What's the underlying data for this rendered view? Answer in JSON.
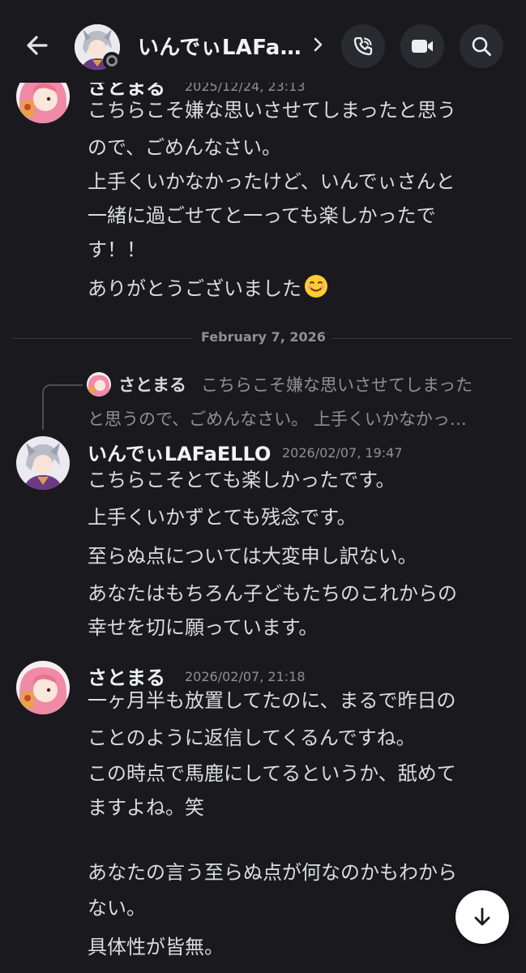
{
  "header": {
    "title": "いんでぃLAFa…",
    "icons": [
      "back-arrow-icon",
      "chevron-right-icon",
      "voice-call-icon",
      "video-call-icon",
      "search-icon"
    ]
  },
  "messages": [
    {
      "author": "さとまる",
      "timestamp": "2025/12/24, 23:13",
      "lines": [
        "こちらこそ嫌な思いさせてしまったと思う",
        "ので、ごめんなさい。",
        "上手くいかなかったけど、いんでぃさんと",
        "一緒に過ごせてと一っても楽しかったで",
        "す！！",
        "ありがとうございました"
      ],
      "emoji": "smiling-face-emoji"
    },
    {
      "author": "いんでぃLAFaELLO",
      "timestamp": "2026/02/07, 19:47",
      "reply": {
        "author": "さとまる",
        "line1": "こちらこそ嫌な思いさせてしまった",
        "line2": "と思うので、ごめんなさい。 上手くいかなかっ…"
      },
      "lines": [
        "こちらこそとても楽しかったです。",
        "上手くいかずとても残念です。",
        "至らぬ点については大変申し訳ない。",
        "あなたはもちろん子どもたちのこれからの",
        "幸せを切に願っています。"
      ]
    },
    {
      "author": "さとまる",
      "timestamp": "2026/02/07, 21:18",
      "lines": [
        "一ヶ月半も放置してたのに、まるで昨日の",
        "ことのように返信してくるんですね。",
        "この時点で馬鹿にしてるというか、舐めて",
        "ますよね。笑",
        "あなたの言う至らぬ点が何なのかもわから",
        "ない。",
        "具体性が皆無。"
      ]
    }
  ],
  "date_divider": "February 7, 2026",
  "colors": {
    "background": "#1a1a1e",
    "text": "#dbdcdf",
    "muted": "#8e9097",
    "button_bg": "#2a2b30"
  }
}
